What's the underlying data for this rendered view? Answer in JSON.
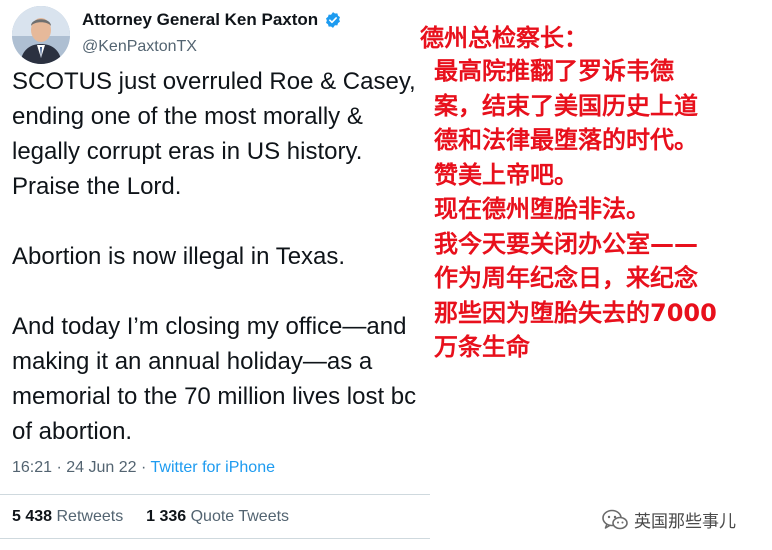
{
  "tweet": {
    "author_name": "Attorney General Ken Paxton",
    "handle": "@KenPaxtonTX",
    "paragraphs": [
      "SCOTUS just overruled Roe & Casey, ending one of the most morally & legally corrupt eras in US history. Praise the Lord.",
      "Abortion is now illegal in Texas.",
      "And today I’m closing my office—and making it an annual holiday—as a memorial to the 70 million lives lost bc of abortion."
    ],
    "time": "16:21",
    "date": "24 Jun 22",
    "separator": "·",
    "source": "Twitter for iPhone",
    "retweets_count": "5 438",
    "retweets_label": "Retweets",
    "quotes_count": "1 336",
    "quotes_label": "Quote Tweets"
  },
  "translation": {
    "title": "德州总检察长：",
    "lines": [
      "最高院推翻了罗诉韦德",
      "案，结束了美国历史上道",
      "德和法律最堕落的时代。",
      "赞美上帝吧。",
      "现在德州堕胎非法。",
      "我今天要关闭办公室——",
      "作为周年纪念日，来纪念",
      "那些因为堕胎失去的7000",
      "万条生命"
    ],
    "color": "#e8101c"
  },
  "watermark": {
    "text": "英国那些事儿",
    "icon": "wechat-icon"
  },
  "colors": {
    "verified": "#1d9bf0",
    "link": "#1d9bf0",
    "muted": "#536471"
  }
}
